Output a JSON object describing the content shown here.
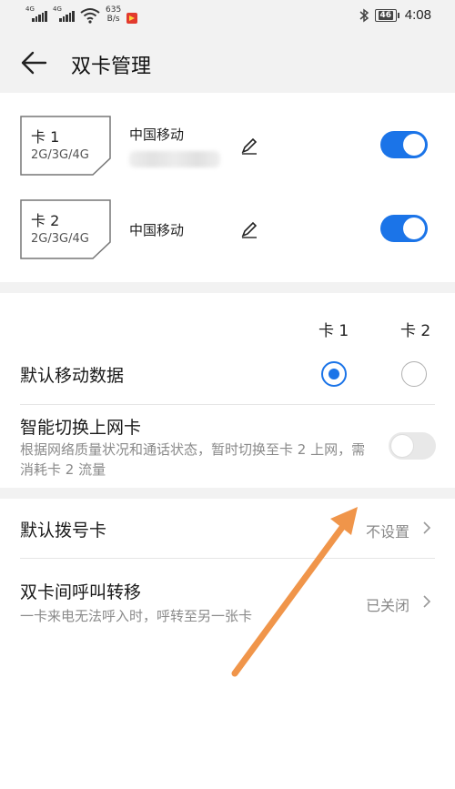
{
  "status_bar": {
    "sim1_net": "4G",
    "sim2_net": "4G",
    "speed_value": "635",
    "speed_unit": "B/s",
    "battery": "46",
    "time": "4:08"
  },
  "header": {
    "title": "双卡管理"
  },
  "cards": [
    {
      "slot": "卡 1",
      "network": "2G/3G/4G",
      "carrier": "中国移动",
      "enabled": true
    },
    {
      "slot": "卡 2",
      "network": "2G/3G/4G",
      "carrier": "中国移动",
      "enabled": true
    }
  ],
  "data_section": {
    "col1": "卡 1",
    "col2": "卡 2",
    "default_data_label": "默认移动数据",
    "default_data_selected": "卡 1",
    "smart_switch_label": "智能切换上网卡",
    "smart_switch_desc": "根据网络质量状况和通话状态，暂时切换至卡 2 上网，需消耗卡 2 流量",
    "smart_switch_enabled": false
  },
  "call_section": {
    "default_dial_label": "默认拨号卡",
    "default_dial_value": "不设置",
    "forward_label": "双卡间呼叫转移",
    "forward_desc": "一卡来电无法呼入时，呼转至另一张卡",
    "forward_value": "已关闭"
  },
  "colors": {
    "accent": "#1b74e8",
    "annotation_arrow": "#f0954a",
    "background_gray": "#f2f2f2"
  }
}
